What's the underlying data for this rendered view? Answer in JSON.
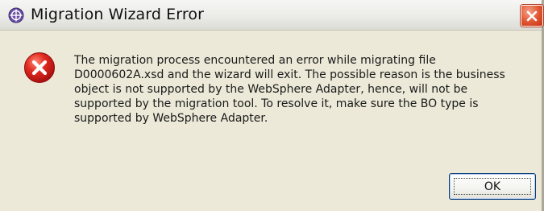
{
  "dialog": {
    "title": "Migration Wizard Error",
    "icons": {
      "title": "wizard-icon",
      "close": "close-icon",
      "status": "error-icon"
    },
    "colors": {
      "close_button": "#e0532f",
      "error_icon": "#d81e1e",
      "background": "#ece9d8"
    },
    "message": "The migration process encountered an error while migrating file\nD0000602A.xsd and the wizard will exit. The possible reason is the business\nobject is not supported by the WebSphere Adapter, hence, will not be\nsupported by the migration tool. To resolve it, make sure the BO type is\nsupported by WebSphere Adapter.",
    "ok_label": "OK"
  }
}
